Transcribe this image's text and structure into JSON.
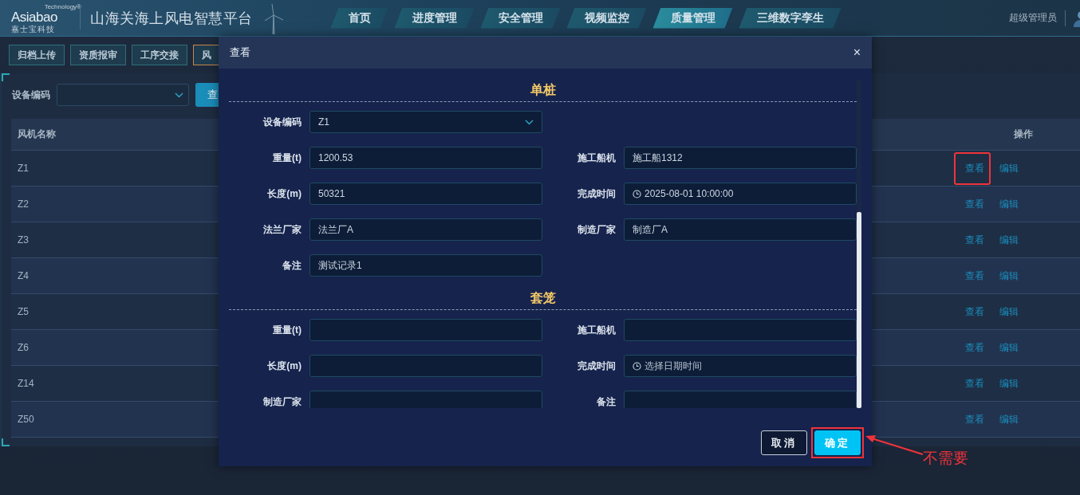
{
  "header": {
    "logo": {
      "brand": "Asiabao",
      "tagline": "Technology®",
      "subtitle": "嘉士宝科技"
    },
    "title": "山海关海上风电智慧平台",
    "nav": [
      {
        "label": "首页",
        "selected": false
      },
      {
        "label": "进度管理",
        "selected": false
      },
      {
        "label": "安全管理",
        "selected": false
      },
      {
        "label": "视频监控",
        "selected": false
      },
      {
        "label": "质量管理",
        "selected": true
      },
      {
        "label": "三维数字孪生",
        "selected": false
      }
    ],
    "user": "超级管理员"
  },
  "subtabs": [
    {
      "label": "归档上传",
      "selected": false
    },
    {
      "label": "资质报审",
      "selected": false
    },
    {
      "label": "工序交接",
      "selected": false
    },
    {
      "label": "风",
      "selected": true
    }
  ],
  "filter": {
    "label": "设备编码",
    "query_button": "查"
  },
  "table": {
    "columns": [
      "风机名称",
      "操作"
    ],
    "rows": [
      {
        "name": "Z1",
        "actions": [
          {
            "label": "查看",
            "highlighted": true
          },
          {
            "label": "编辑",
            "highlighted": false
          }
        ]
      },
      {
        "name": "Z2",
        "actions": [
          {
            "label": "查看",
            "highlighted": false
          },
          {
            "label": "编辑",
            "highlighted": false
          }
        ]
      },
      {
        "name": "Z3",
        "actions": [
          {
            "label": "查看",
            "highlighted": false
          },
          {
            "label": "编辑",
            "highlighted": false
          }
        ]
      },
      {
        "name": "Z4",
        "actions": [
          {
            "label": "查看",
            "highlighted": false
          },
          {
            "label": "编辑",
            "highlighted": false
          }
        ]
      },
      {
        "name": "Z5",
        "actions": [
          {
            "label": "查看",
            "highlighted": false
          },
          {
            "label": "编辑",
            "highlighted": false
          }
        ]
      },
      {
        "name": "Z6",
        "actions": [
          {
            "label": "查看",
            "highlighted": false
          },
          {
            "label": "编辑",
            "highlighted": false
          }
        ]
      },
      {
        "name": "Z14",
        "actions": [
          {
            "label": "查看",
            "highlighted": false
          },
          {
            "label": "编辑",
            "highlighted": false
          }
        ]
      },
      {
        "name": "Z50",
        "actions": [
          {
            "label": "查看",
            "highlighted": false
          },
          {
            "label": "编辑",
            "highlighted": false
          }
        ]
      }
    ]
  },
  "dialog": {
    "title": "查看",
    "close": "×",
    "sections": [
      {
        "title": "单桩",
        "rows": [
          [
            {
              "label": "设备编码",
              "kind": "select",
              "value": "Z1"
            }
          ],
          [
            {
              "label": "重量(t)",
              "kind": "text",
              "value": "1200.53"
            },
            {
              "label": "施工船机",
              "kind": "text",
              "value": "施工船1312"
            }
          ],
          [
            {
              "label": "长度(m)",
              "kind": "text",
              "value": "50321"
            },
            {
              "label": "完成时间",
              "kind": "datetime",
              "value": "2025-08-01 10:00:00"
            }
          ],
          [
            {
              "label": "法兰厂家",
              "kind": "text",
              "value": "法兰厂A"
            },
            {
              "label": "制造厂家",
              "kind": "text",
              "value": "制造厂A"
            }
          ],
          [
            {
              "label": "备注",
              "kind": "text",
              "value": "测试记录1"
            }
          ]
        ]
      },
      {
        "title": "套笼",
        "rows": [
          [
            {
              "label": "重量(t)",
              "kind": "text"
            },
            {
              "label": "施工船机",
              "kind": "text"
            }
          ],
          [
            {
              "label": "长度(m)",
              "kind": "text"
            },
            {
              "label": "完成时间",
              "kind": "datetime",
              "placeholder": "选择日期时间"
            }
          ],
          [
            {
              "label": "制造厂家",
              "kind": "text"
            },
            {
              "label": "备注",
              "kind": "text"
            }
          ]
        ]
      }
    ],
    "buttons": [
      {
        "label": "取消",
        "kind": "secondary",
        "highlighted": false
      },
      {
        "label": "确定",
        "kind": "primary",
        "highlighted": true
      }
    ]
  },
  "annotation": {
    "text": "不需要"
  }
}
